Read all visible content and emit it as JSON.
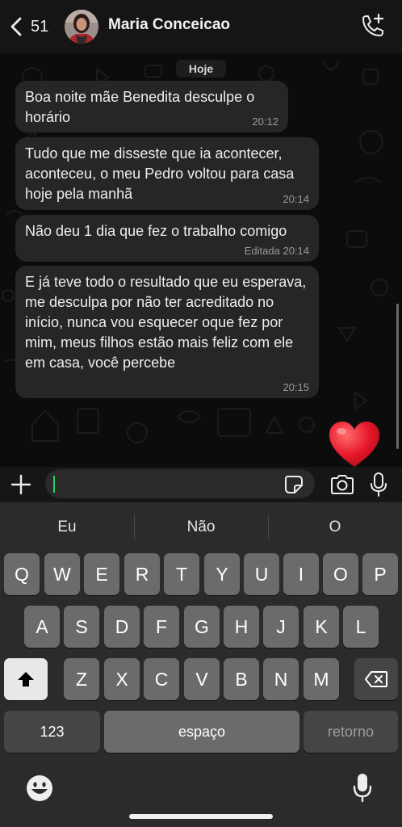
{
  "header": {
    "back_count": "51",
    "contact_name": "Maria Conceicao"
  },
  "chat": {
    "date_label": "Hoje",
    "messages": [
      {
        "text": "Boa noite mãe Benedita desculpe o horário",
        "time": "20:12"
      },
      {
        "text": "Tudo que me disseste que ia acontecer, aconteceu, o meu Pedro voltou para casa hoje pela manhã",
        "time": "20:14"
      },
      {
        "text": "Não deu 1 dia que fez o trabalho comigo",
        "time": "Editada 20:14"
      },
      {
        "text": "E já teve todo o resultado que eu esperava, me desculpa por não ter acreditado no início, nunca vou esquecer oque fez por mim, meus filhos estão mais feliz com ele em casa, você percebe",
        "time": "20:15"
      }
    ],
    "reaction_emoji": "heart"
  },
  "input_bar": {
    "value": ""
  },
  "keyboard": {
    "suggestions": [
      "Eu",
      "Não",
      "O"
    ],
    "row1": [
      "Q",
      "W",
      "E",
      "R",
      "T",
      "Y",
      "U",
      "I",
      "O",
      "P"
    ],
    "row2": [
      "A",
      "S",
      "D",
      "F",
      "G",
      "H",
      "J",
      "K",
      "L"
    ],
    "row3": [
      "Z",
      "X",
      "C",
      "V",
      "B",
      "N",
      "M"
    ],
    "numbers_label": "123",
    "space_label": "espaço",
    "return_label": "retorno"
  },
  "colors": {
    "header_bg": "#151515",
    "bubble_bg": "#262626",
    "caret": "#25d366",
    "heart": "#e8172b",
    "key_bg": "#6b6b6b",
    "key_dark_bg": "#454545"
  },
  "icons": [
    "chevron-left-icon",
    "add-call-icon",
    "plus-icon",
    "sticker-icon",
    "camera-icon",
    "microphone-icon",
    "shift-icon",
    "backspace-icon",
    "emoji-icon",
    "dictation-icon",
    "heart-emoji"
  ]
}
